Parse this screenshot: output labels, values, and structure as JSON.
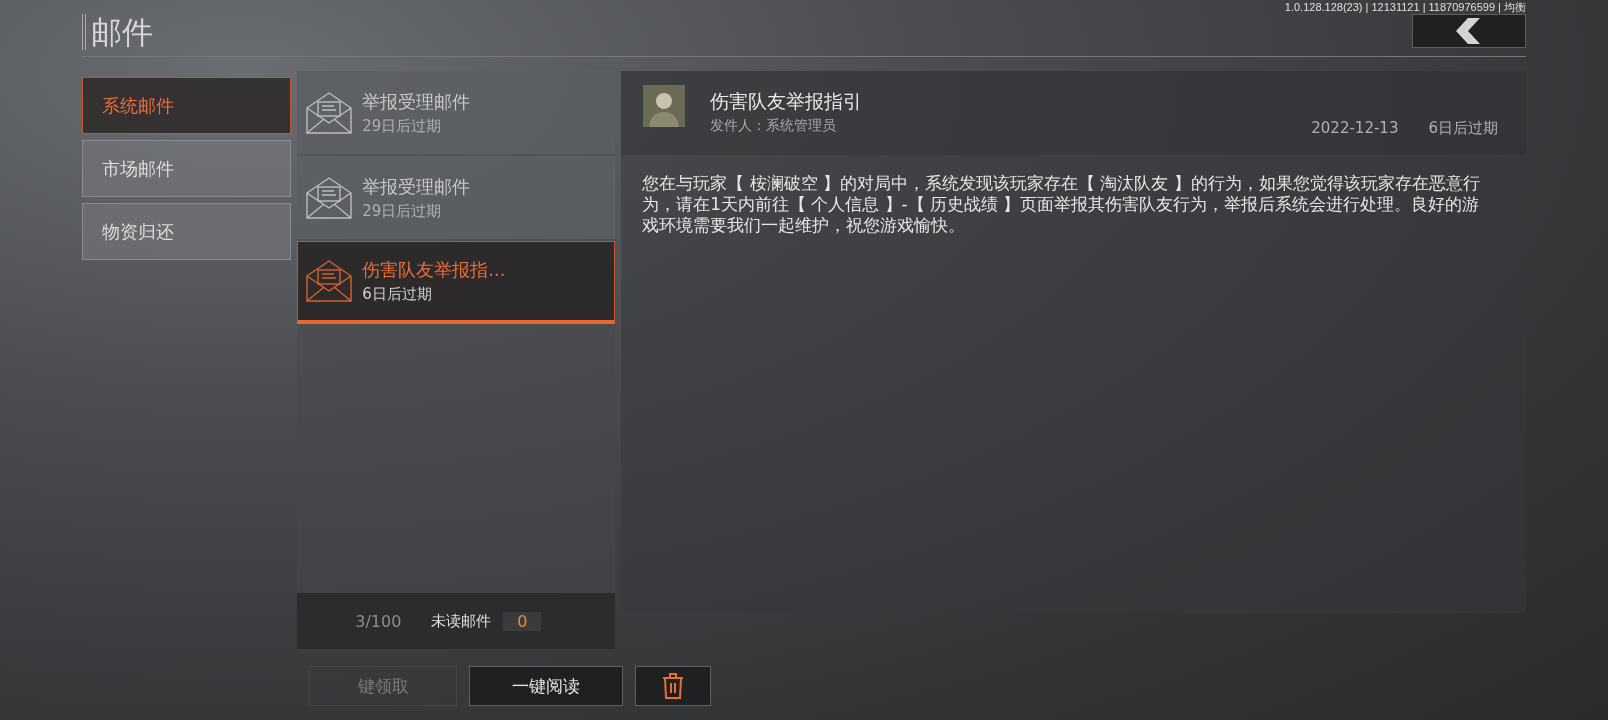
{
  "header": {
    "title": "邮件",
    "version": "1.0.128.128(23) | 12131121 | 11870976599 | 均衡"
  },
  "categories": [
    {
      "label": "系统邮件",
      "selected": true
    },
    {
      "label": "市场邮件",
      "selected": false
    },
    {
      "label": "物资归还",
      "selected": false
    }
  ],
  "mails": [
    {
      "title": "举报受理邮件",
      "expiry": "29日后过期",
      "selected": false
    },
    {
      "title": "举报受理邮件",
      "expiry": "29日后过期",
      "selected": false
    },
    {
      "title": "伤害队友举报指...",
      "expiry": "6日后过期",
      "selected": true
    }
  ],
  "mail_footer": {
    "count": "3/100",
    "unread_label": "未读邮件",
    "unread_count": "0"
  },
  "detail": {
    "title": "伤害队友举报指引",
    "sender": "发件人：系统管理员",
    "date": "2022-12-13",
    "expiry": "6日后过期",
    "body": "您在与玩家【 桉澜破空 】的对局中，系统发现该玩家存在【 淘汰队友 】的行为，如果您觉得该玩家存在恶意行为，请在1天内前往【 个人信息 】-【 历史战绩 】页面举报其伤害队友行为，举报后系统会进行处理。良好的游戏环境需要我们一起维护，祝您游戏愉快。"
  },
  "actions": [
    {
      "kind": "text",
      "label": "键领取",
      "disabled": true
    },
    {
      "kind": "text",
      "label": "一键阅读",
      "disabled": false
    },
    {
      "kind": "delete",
      "disabled": false
    }
  ]
}
